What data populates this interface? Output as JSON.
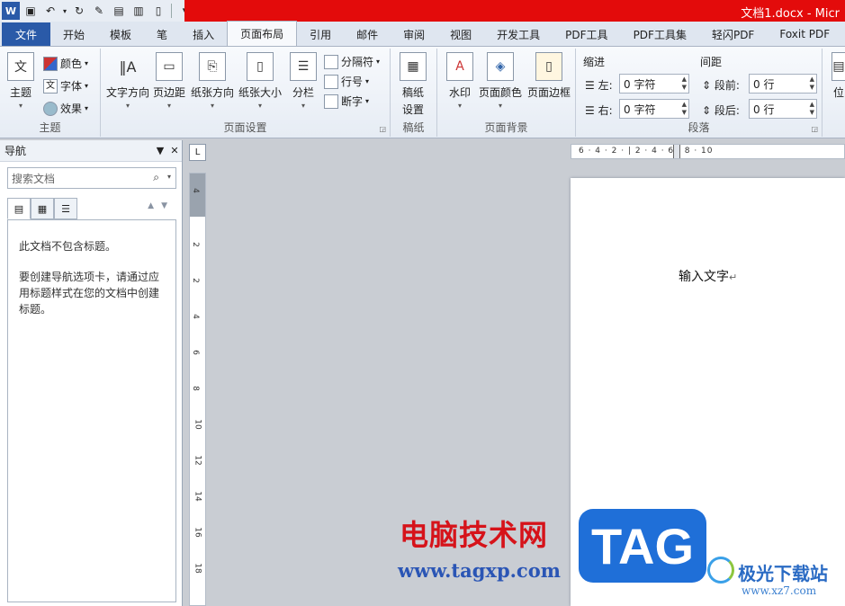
{
  "window": {
    "title": "文档1.docx - Micr"
  },
  "tabs": [
    {
      "label": "文件",
      "kind": "file"
    },
    {
      "label": "开始"
    },
    {
      "label": "模板"
    },
    {
      "label": "笔"
    },
    {
      "label": "插入"
    },
    {
      "label": "页面布局",
      "active": true
    },
    {
      "label": "引用"
    },
    {
      "label": "邮件"
    },
    {
      "label": "审阅"
    },
    {
      "label": "视图"
    },
    {
      "label": "开发工具"
    },
    {
      "label": "PDF工具"
    },
    {
      "label": "PDF工具集"
    },
    {
      "label": "轻闪PDF"
    },
    {
      "label": "Foxit PDF"
    }
  ],
  "ribbon": {
    "theme": {
      "label": "主题",
      "themes": "主题",
      "colors": "颜色",
      "fonts": "字体",
      "effects": "效果"
    },
    "page_setup": {
      "label": "页面设置",
      "text_direction": "文字方向",
      "margins": "页边距",
      "orientation": "纸张方向",
      "size": "纸张大小",
      "columns": "分栏",
      "breaks": "分隔符",
      "line_numbers": "行号",
      "hyphenation": "断字"
    },
    "manuscript": {
      "label": "稿纸",
      "settings": "稿纸\n设置",
      "settings_line1": "稿纸",
      "settings_line2": "设置"
    },
    "page_background": {
      "label": "页面背景",
      "watermark": "水印",
      "page_color": "页面颜色",
      "page_borders": "页面边框"
    },
    "paragraph": {
      "label": "段落",
      "indent_title": "缩进",
      "spacing_title": "间距",
      "indent_left_label": "左:",
      "indent_left_value": "0 字符",
      "indent_right_label": "右:",
      "indent_right_value": "0 字符",
      "spacing_before_label": "段前:",
      "spacing_before_value": "0 行",
      "spacing_after_label": "段后:",
      "spacing_after_value": "0 行"
    },
    "arrange_partial": "位"
  },
  "navigation": {
    "title": "导航",
    "search_placeholder": "搜索文档",
    "empty_line1": "此文档不包含标题。",
    "empty_line2": "要创建导航选项卡，请通过应用标题样式在您的文档中创建标题。"
  },
  "ruler": {
    "corner": "L",
    "horizontal_marks": "6 · 4 · 2 · | 2 · 4 · 6 · 8 · 10",
    "vertical_ticks": [
      "4",
      "2",
      "2",
      "4",
      "6",
      "8",
      "10",
      "12",
      "14",
      "16",
      "18"
    ]
  },
  "document": {
    "text": "输入文字",
    "paragraph_mark": "↵"
  },
  "watermark": {
    "brand_cn": "电脑技术网",
    "brand_url": "www.tagxp.com",
    "tag": "TAG",
    "site_cn": "极光下载站",
    "site_url": "www.xz7.com"
  },
  "colors": {
    "title_bar": "#e30b0b",
    "file_tab": "#2a5aa8",
    "tag_badge": "#1f6fd8"
  }
}
